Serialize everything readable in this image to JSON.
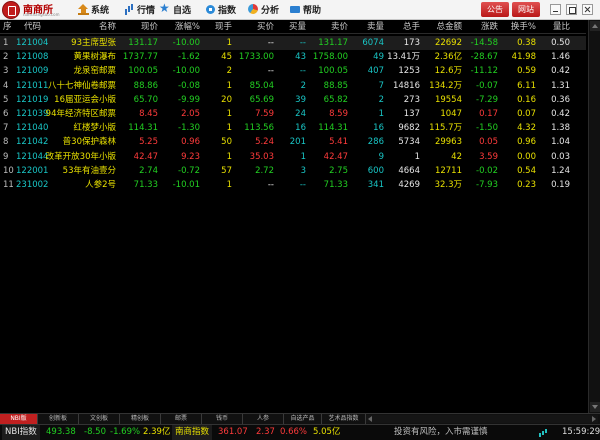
{
  "app": {
    "logo_name": "南商所",
    "logo_sub": "nanshangsuo.com"
  },
  "menu": [
    {
      "label": "系统",
      "icon": "home-icon"
    },
    {
      "label": "行情",
      "icon": "quote-icon"
    },
    {
      "label": "自选",
      "icon": "star-icon"
    },
    {
      "label": "指数",
      "icon": "index-icon"
    },
    {
      "label": "分析",
      "icon": "analysis-icon"
    },
    {
      "label": "帮助",
      "icon": "help-icon"
    }
  ],
  "buttons": {
    "notice": "公告",
    "site": "网站"
  },
  "table": {
    "headers": [
      "序",
      "代码",
      "名称",
      "现价",
      "涨幅%",
      "现手",
      "买价",
      "买量",
      "卖价",
      "卖量",
      "总手",
      "总金额",
      "涨跌",
      "换手%",
      "量比"
    ],
    "rows": [
      {
        "idx": "1",
        "code": "121004",
        "name": "93主席型张",
        "price": "131.17",
        "chg_pct": "-10.00",
        "vol": "1",
        "bid": "--",
        "bid_qty": "--",
        "ask": "131.17",
        "ask_qty": "6074",
        "total_vol": "173",
        "amount": "22692",
        "change": "-14.58",
        "turnover": "0.38",
        "vol_ratio": "0.50",
        "dir": "down"
      },
      {
        "idx": "2",
        "code": "121008",
        "name": "黄果树瀑布",
        "price": "1737.77",
        "chg_pct": "-1.62",
        "vol": "45",
        "bid": "1733.00",
        "bid_qty": "43",
        "ask": "1758.00",
        "ask_qty": "49",
        "total_vol": "13.41万",
        "amount": "2.36亿",
        "change": "-28.67",
        "turnover": "41.98",
        "vol_ratio": "1.46",
        "dir": "down"
      },
      {
        "idx": "3",
        "code": "121009",
        "name": "龙泉窑邮票",
        "price": "100.05",
        "chg_pct": "-10.00",
        "vol": "2",
        "bid": "--",
        "bid_qty": "--",
        "ask": "100.05",
        "ask_qty": "407",
        "total_vol": "1253",
        "amount": "12.6万",
        "change": "-11.12",
        "turnover": "0.59",
        "vol_ratio": "0.42",
        "dir": "down"
      },
      {
        "idx": "4",
        "code": "121011",
        "name": "八十七神仙卷邮票",
        "price": "88.86",
        "chg_pct": "-0.08",
        "vol": "1",
        "bid": "85.04",
        "bid_qty": "2",
        "ask": "88.85",
        "ask_qty": "7",
        "total_vol": "14816",
        "amount": "134.2万",
        "change": "-0.07",
        "turnover": "6.11",
        "vol_ratio": "1.31",
        "dir": "down"
      },
      {
        "idx": "5",
        "code": "121019",
        "name": "16届亚运会小版",
        "price": "65.70",
        "chg_pct": "-9.99",
        "vol": "20",
        "bid": "65.69",
        "bid_qty": "39",
        "ask": "65.82",
        "ask_qty": "2",
        "total_vol": "273",
        "amount": "19554",
        "change": "-7.29",
        "turnover": "0.16",
        "vol_ratio": "0.36",
        "dir": "down"
      },
      {
        "idx": "6",
        "code": "121039",
        "name": "94年经济特区邮票",
        "price": "8.45",
        "chg_pct": "2.05",
        "vol": "1",
        "bid": "7.59",
        "bid_qty": "24",
        "ask": "8.59",
        "ask_qty": "1",
        "total_vol": "137",
        "amount": "1047",
        "change": "0.17",
        "turnover": "0.07",
        "vol_ratio": "0.42",
        "dir": "up"
      },
      {
        "idx": "7",
        "code": "121040",
        "name": "红楼梦小版",
        "price": "114.31",
        "chg_pct": "-1.30",
        "vol": "1",
        "bid": "113.56",
        "bid_qty": "16",
        "ask": "114.31",
        "ask_qty": "16",
        "total_vol": "9682",
        "amount": "115.7万",
        "change": "-1.50",
        "turnover": "4.32",
        "vol_ratio": "1.38",
        "dir": "down"
      },
      {
        "idx": "8",
        "code": "121042",
        "name": "普30保护森林",
        "price": "5.25",
        "chg_pct": "0.96",
        "vol": "50",
        "bid": "5.24",
        "bid_qty": "201",
        "ask": "5.41",
        "ask_qty": "286",
        "total_vol": "5734",
        "amount": "29963",
        "change": "0.05",
        "turnover": "0.96",
        "vol_ratio": "1.04",
        "dir": "up"
      },
      {
        "idx": "9",
        "code": "121044",
        "name": "改革开放30年小版",
        "price": "42.47",
        "chg_pct": "9.23",
        "vol": "1",
        "bid": "35.03",
        "bid_qty": "1",
        "ask": "42.47",
        "ask_qty": "9",
        "total_vol": "1",
        "amount": "42",
        "change": "3.59",
        "turnover": "0.00",
        "vol_ratio": "0.03",
        "dir": "up"
      },
      {
        "idx": "10",
        "code": "122001",
        "name": "53年有油壹分",
        "price": "2.74",
        "chg_pct": "-0.72",
        "vol": "57",
        "bid": "2.72",
        "bid_qty": "3",
        "ask": "2.75",
        "ask_qty": "600",
        "total_vol": "4664",
        "amount": "12711",
        "change": "-0.02",
        "turnover": "0.54",
        "vol_ratio": "1.24",
        "dir": "down"
      },
      {
        "idx": "11",
        "code": "231002",
        "name": "人参2号",
        "price": "71.33",
        "chg_pct": "-10.01",
        "vol": "1",
        "bid": "--",
        "bid_qty": "--",
        "ask": "71.33",
        "ask_qty": "341",
        "total_vol": "4269",
        "amount": "32.3万",
        "change": "-7.93",
        "turnover": "0.23",
        "vol_ratio": "0.19",
        "dir": "down"
      }
    ]
  },
  "tabs": [
    "NBI版",
    "创新板",
    "文创板",
    "精创板",
    "邮票",
    "钱币",
    "人参",
    "自选产品",
    "艺术品指数"
  ],
  "status": {
    "index1_label": "NBI指数",
    "index1_value": "493.38",
    "index1_change": "-8.50",
    "index1_pct": "-1.69%",
    "index1_amount": "2.39亿",
    "index2_label": "南商指数",
    "index2_value": "361.07",
    "index2_change": "2.37",
    "index2_pct": "0.66%",
    "index2_amount": "5.05亿",
    "notice": "投资有风险，入市需谨慎",
    "time": "15:59:29"
  }
}
